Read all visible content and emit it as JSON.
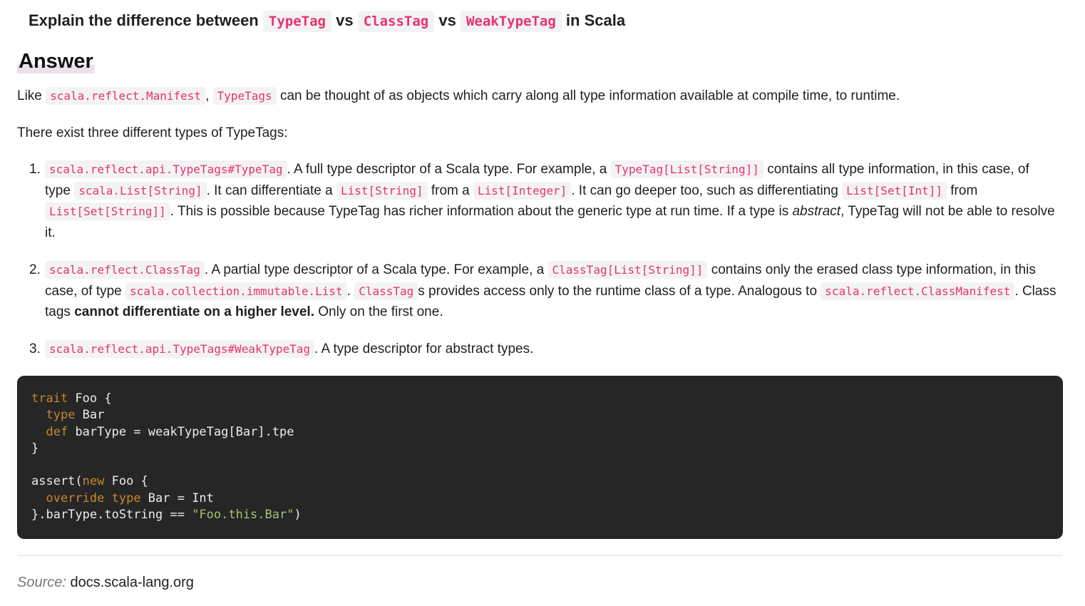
{
  "question": {
    "prefix": "Explain the difference between",
    "tag1": "TypeTag",
    "vs1": "vs",
    "tag2": "ClassTag",
    "vs2": "vs",
    "tag3": "WeakTypeTag",
    "suffix": "in Scala"
  },
  "answer": {
    "heading": "Answer",
    "intro": {
      "word_like": "Like",
      "code_manifest": "scala.reflect.Manifest",
      "comma": ",",
      "code_typetags": "TypeTags",
      "rest": "can be thought of as objects which carry along all type information available at compile time, to runtime."
    },
    "three_types": "There exist three different types of TypeTags:",
    "items": [
      {
        "number": "1.",
        "code_main": "scala.reflect.api.TypeTags#TypeTag",
        "t1": ". A full type descriptor of a Scala type. For example, a",
        "code_example": "TypeTag[List[String]]",
        "t2": "contains all type information, in this case, of type",
        "code_type": "scala.List[String]",
        "t3": ". It can differentiate a",
        "code_a": "List[String]",
        "t4": "from a",
        "code_b": "List[Integer]",
        "t5": ". It can go deeper too, such as differentiating",
        "code_c": "List[Set[Int]]",
        "t6": "from",
        "code_d": "List[Set[String]]",
        "t7": ". This is possible because TypeTag has richer information about the generic type at run time. If a type is",
        "em": "abstract",
        "t8": ", TypeTag will not be able to resolve it."
      },
      {
        "number": "2.",
        "code_main": "scala.reflect.ClassTag",
        "t1": ". A partial type descriptor of a Scala type. For example, a",
        "code_example": "ClassTag[List[String]]",
        "t2": "contains only the erased class type information, in this case, of type",
        "code_type": "scala.collection.immutable.List",
        "t3": ".",
        "code_classtag": "ClassTag",
        "t4": "s provides access only to the runtime class of a type. Analogous to",
        "code_manifest": "scala.reflect.ClassManifest",
        "t5": ". Class tags",
        "strong": "cannot differentiate on a higher level.",
        "t6": "Only on the first one."
      },
      {
        "number": "3.",
        "code_main": "scala.reflect.api.TypeTags#WeakTypeTag",
        "t1": ". A type descriptor for abstract types."
      }
    ]
  },
  "code": {
    "l1_kw": "trait",
    "l1_rest": " Foo {",
    "l2_kw": "type",
    "l2_rest": " Bar",
    "l3_kw": "def",
    "l3_rest": " barType = weakTypeTag[Bar].tpe",
    "l4": "}",
    "l6_pre": "assert(",
    "l6_kw": "new",
    "l6_rest": " Foo {",
    "l7_kw": "override type",
    "l7_rest": " Bar = Int",
    "l8_pre": "}.barType.toString == ",
    "l8_str": "\"Foo.this.Bar\"",
    "l8_post": ")"
  },
  "source": {
    "label": "Source:",
    "value": "docs.scala-lang.org"
  },
  "colors": {
    "inline_code": "#e8336d",
    "code_bg": "#262626",
    "keyword": "#c7882e",
    "string": "#a9bf79"
  }
}
